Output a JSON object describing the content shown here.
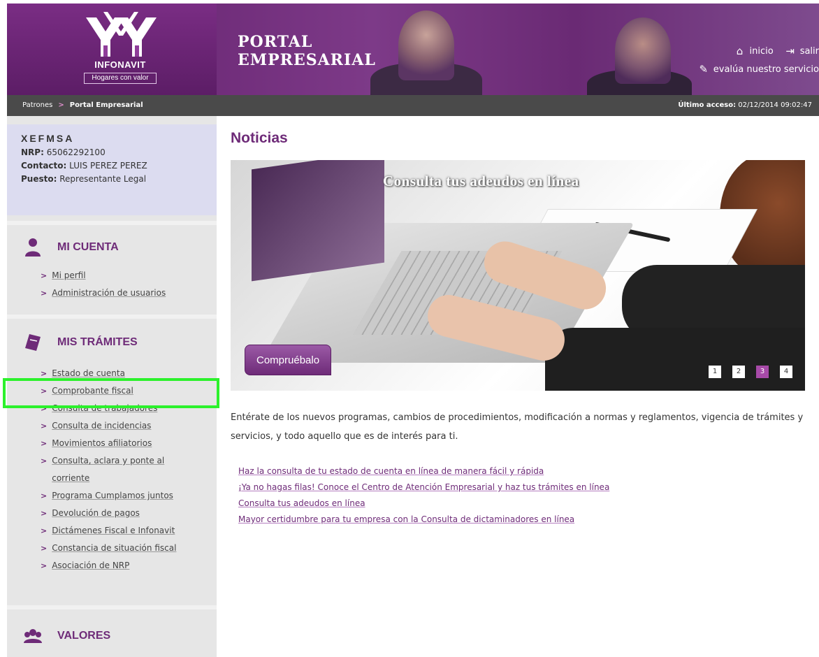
{
  "header": {
    "logo_name": "INFONAVIT",
    "logo_tagline": "Hogares con valor",
    "portal_title_line1": "PORTAL",
    "portal_title_line2": "EMPRESARIAL",
    "home_label": "inicio",
    "logout_label": "salir",
    "survey_label": "evalúa nuestro servicio"
  },
  "breadcrumb": {
    "items": [
      "Patrones",
      "Portal Empresarial"
    ],
    "last_access_label": "Último acceso:",
    "last_access_value": "02/12/2014 09:02:47"
  },
  "profile": {
    "company": "XEFMSA",
    "nrp_label": "NRP:",
    "nrp_value": "65062292100",
    "contact_label": "Contacto:",
    "contact_value": "LUIS PEREZ PEREZ",
    "position_label": "Puesto:",
    "position_value": "Representante Legal"
  },
  "sections": {
    "mi_cuenta": {
      "title": "MI CUENTA",
      "items": [
        "Mi perfil",
        "Administración de usuarios"
      ]
    },
    "mis_tramites": {
      "title": "MIS TRÁMITES",
      "items": [
        "Estado de cuenta",
        "Comprobante fiscal",
        "Consulta de trabajadores",
        "Consulta de incidencias",
        "Movimientos afiliatorios",
        "Consulta, aclara y ponte al corriente",
        "Programa Cumplamos juntos",
        "Devolución de pagos",
        "Dictámenes Fiscal e Infonavit",
        "Constancia de situación fiscal",
        "Asociación de NRP"
      ]
    },
    "valores": {
      "title": "VALORES"
    }
  },
  "main": {
    "title": "Noticias",
    "banner_title": "Consulta tus adeudos en línea",
    "banner_cta": "Compruébalo",
    "pager": [
      "1",
      "2",
      "3",
      "4"
    ],
    "pager_active": "3",
    "intro": "Entérate de los nuevos programas, cambios de procedimientos, modificación a normas y reglamentos, vigencia de trámites y servicios, y todo aquello que es de interés para ti.",
    "links": [
      "Haz la consulta de tu estado de cuenta en línea de manera fácil y rápida",
      "¡Ya no hagas filas! Conoce el Centro de Atención Empresarial y haz tus trámites en línea",
      "Consulta tus adeudos en línea",
      "Mayor certidumbre para tu empresa con la Consulta de dictaminadores en línea"
    ]
  },
  "colors": {
    "brand_purple": "#6e2b78",
    "highlight_green": "#2cf12c",
    "active_page": "#a74aa8"
  }
}
